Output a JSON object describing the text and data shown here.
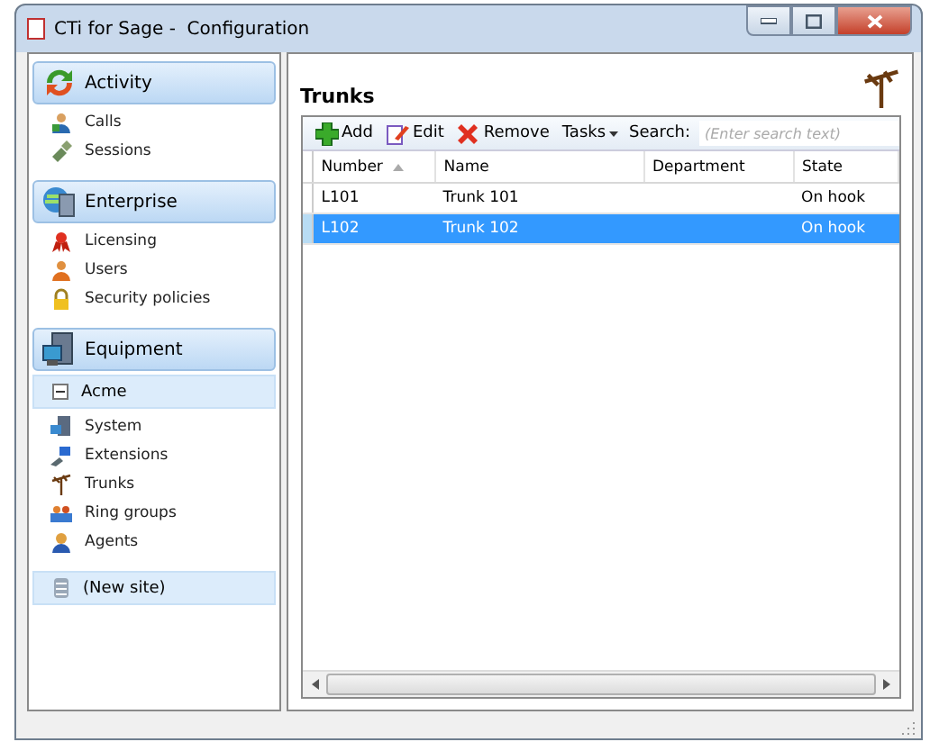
{
  "window": {
    "title": "CTi for Sage -  Configuration"
  },
  "sidebar": {
    "groups": [
      {
        "title": "Activity",
        "items": [
          "Calls",
          "Sessions"
        ]
      },
      {
        "title": "Enterprise",
        "items": [
          "Licensing",
          "Users",
          "Security policies"
        ]
      }
    ],
    "equipment": {
      "title": "Equipment",
      "sites": [
        {
          "label": "Acme",
          "expanded": true,
          "items": [
            "System",
            "Extensions",
            "Trunks",
            "Ring groups",
            "Agents"
          ]
        }
      ],
      "new_site": "(New site)"
    }
  },
  "content": {
    "title": "Trunks",
    "toolbar": {
      "buttons": [
        {
          "label": "Add",
          "kind": "add"
        },
        {
          "label": "Edit",
          "kind": "edit"
        },
        {
          "label": "Remove",
          "kind": "remove"
        },
        {
          "label": "Tasks",
          "kind": "menu"
        }
      ],
      "search_label": "Search:",
      "search": {
        "placeholder": "(Enter search text)"
      }
    },
    "table": {
      "columns": [
        {
          "label": "Number",
          "sorted": true
        },
        {
          "label": "Name",
          "sorted": false
        },
        {
          "label": "Department",
          "sorted": false
        },
        {
          "label": "State",
          "sorted": false
        }
      ],
      "rows": [
        {
          "cells": [
            "L101",
            "Trunk 101",
            "",
            "On hook"
          ],
          "selected": false
        },
        {
          "cells": [
            "L102",
            "Trunk 102",
            "",
            "On hook"
          ],
          "selected": true
        }
      ]
    }
  }
}
